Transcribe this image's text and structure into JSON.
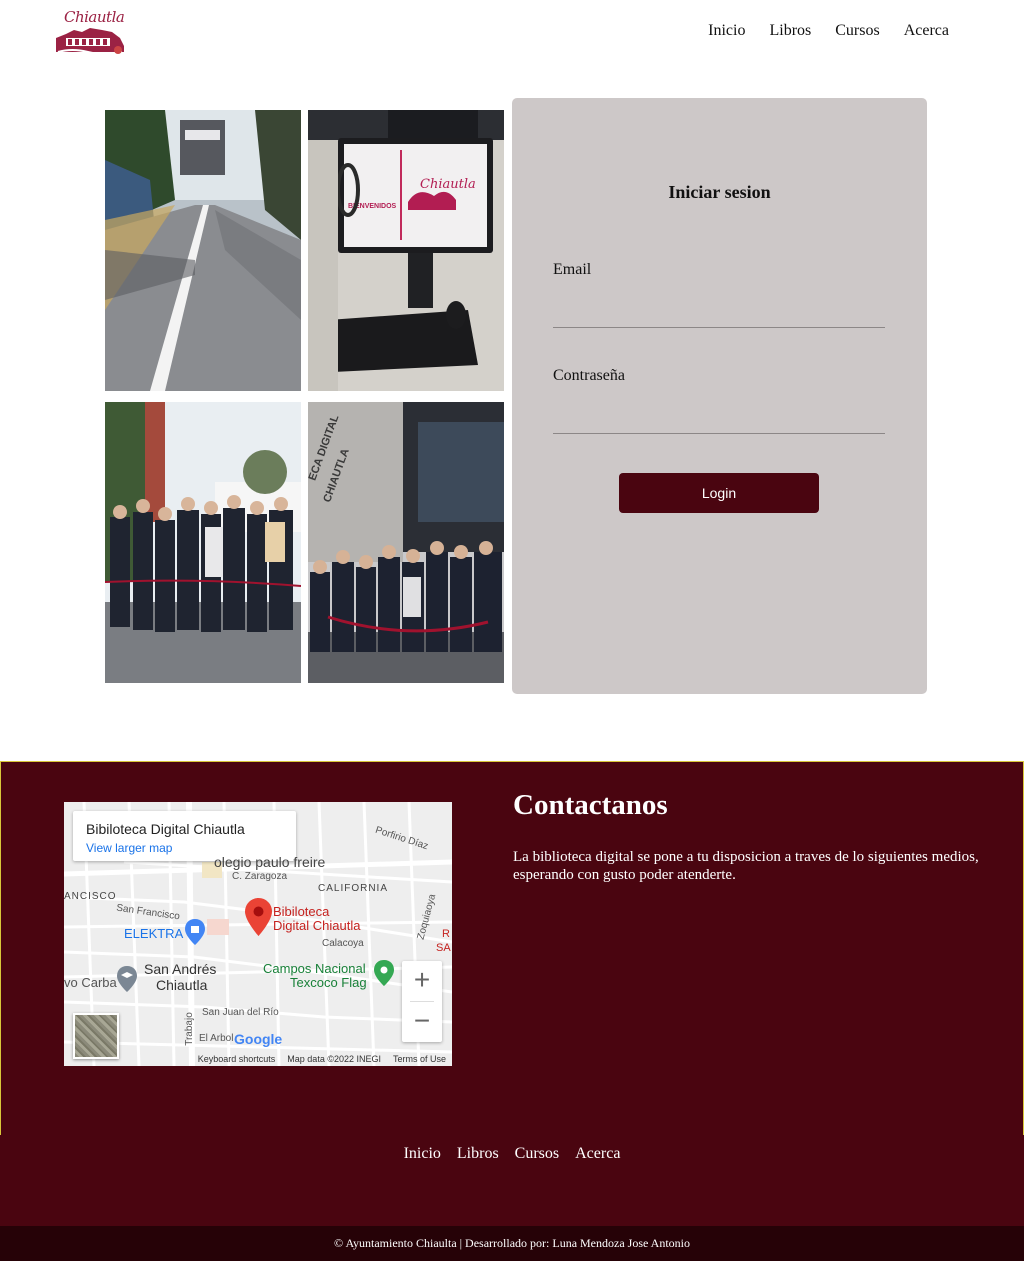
{
  "brand": {
    "logo_text": "Chiautla"
  },
  "nav": {
    "items": [
      "Inicio",
      "Libros",
      "Cursos",
      "Acerca"
    ]
  },
  "login": {
    "title": "Iniciar sesion",
    "email_label": "Email",
    "email_value": "",
    "password_label": "Contraseña",
    "password_value": "",
    "button_label": "Login"
  },
  "gallery": {
    "monitor_text": "BIENVENIDOS",
    "monitor_brand": "Chiautla",
    "building_text": "ECA DIGITAL",
    "building_text_2": "CHIAUTLA"
  },
  "map": {
    "card_title": "Bibiloteca Digital Chiautla",
    "card_link": "View larger map",
    "labels": {
      "paulo_freire": "olegio paulo freire",
      "zaragoza": "C. Zaragoza",
      "california": "CALIFORNIA",
      "porfirio": "Porfirio Díaz",
      "francisco_edge": "ANCISCO",
      "san_francisco": "San Francisco",
      "elektra": "ELEKTRA",
      "biblioteca": "Bibiloteca",
      "biblioteca_2": "Digital Chiautla",
      "calacoya": "Calacoya",
      "zoquiapan": "Zoquiaoya",
      "san_andres": "San Andrés",
      "chiautla": "Chiautla",
      "campos": "Campos Nacional",
      "texcoco": "Texcoco Flag",
      "carba": "vo Carba",
      "san_juan": "San Juan del Río",
      "arbol": "El Arbol",
      "trabajo": "Trabajo",
      "edge_r": "R",
      "edge_sa": "SA"
    },
    "google": "Google",
    "footer": [
      "Keyboard shortcuts",
      "Map data ©2022 INEGI",
      "Terms of Use"
    ],
    "zoom_in": "+",
    "zoom_out": "−"
  },
  "contact": {
    "title": "Contactanos",
    "text": "La biblioteca digital se pone a tu disposicion a traves de lo siguientes medios, esperando con gusto poder atenderte."
  },
  "footer": {
    "nav": [
      "Inicio",
      "Libros",
      "Cursos",
      "Acerca"
    ],
    "copyright": "© Ayuntamiento Chiaulta | Desarrollado por: Luna Mendoza Jose Antonio"
  },
  "colors": {
    "maroon": "#4a0510",
    "dark_maroon": "#260207",
    "card_gray": "#cdc8c8",
    "accent_pink": "#9b2244"
  }
}
